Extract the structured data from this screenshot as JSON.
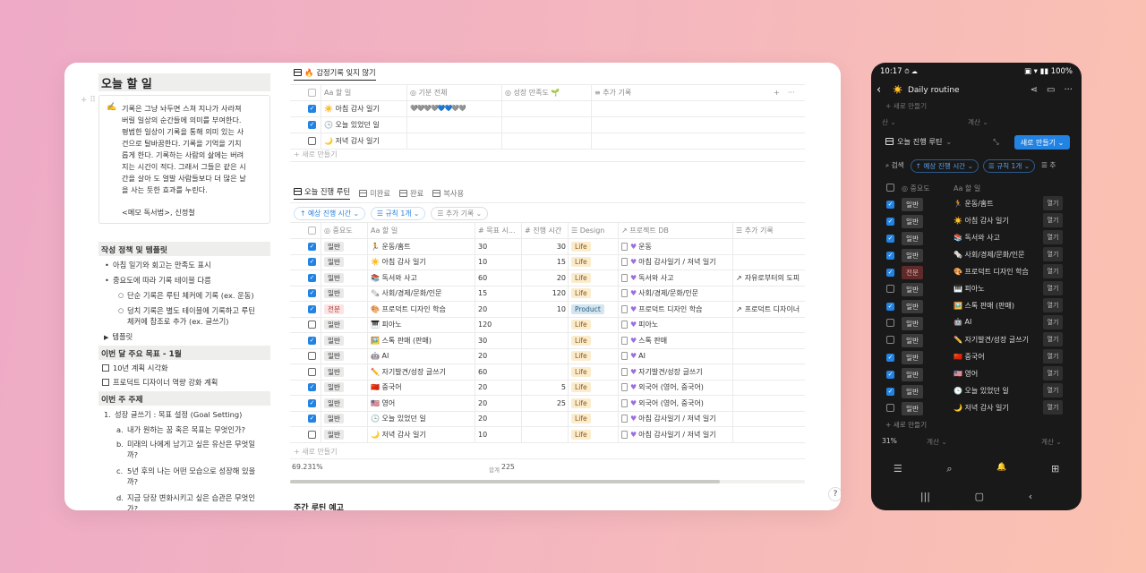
{
  "left": {
    "title": "오늘 할 일",
    "callout_lines": [
      "기록은 그냥 놔두면 스쳐 지나가 사라져",
      "버릴 일상의 순간들에 의미를 부여한다.",
      "평범한 일상이 기록을 통해 의미 있는 사",
      "건으로 탈바꿈한다. 기록을 기억을 기치",
      "롭게 한다. 기록하는 사람의 삶에는 버려",
      "지는 시간이 적다. 그래서 그들은 같은 시",
      "간을 살아 도 얼발 사람들보다 더 많은 날",
      "을 사는 듯한 효과를 누린다."
    ],
    "callout_memo": "<메모 독서법>, 신정철",
    "sec1": "작성 정책 및 템플릿",
    "sec1_items": [
      "아침 일기와 회고는 만족도 표시",
      "중요도에 따라 기록 테이블 다름"
    ],
    "sec1_sub": [
      "단순 기록은 루틴 체커에 기록 (ex. 운동)",
      "덩치 기록은 별도 테이블에 기록하고 루틴",
      "체커에 참조로 추가 (ex. 글쓰기)"
    ],
    "template_toggle": "템플릿",
    "sec2": "이번 달 주요 목표 - 1월",
    "goals": [
      "10년 계획 시각화",
      "프로덕트 디자이너 역량 강화 계획"
    ],
    "sec3": "이번 주 주제",
    "topic1": "성장 글쓰기 : 목표 설정 (Goal Setting)",
    "topic_items": [
      "내가 원하는 꿈 혹은 목표는 무엇인가?",
      "미래의 나에게 남기고 싶은 유산은 무엇일",
      "까?",
      "5년 후의 나는 어떤 모습으로 성장해 있을",
      "까?",
      "지금 당장 변화시키고 싶은 습관은 무엇인",
      "가?"
    ],
    "topic_markers": [
      "1.",
      "a.",
      "b.",
      "c.",
      "d."
    ]
  },
  "db1": {
    "tab": "감정기록 잊지 않기",
    "tab_emoji": "🔥",
    "headers": [
      "할 일",
      "기분 전체",
      "성장 만족도",
      "추가 기록"
    ],
    "header_prefix": [
      "Aa",
      "◎",
      "◎",
      "≡"
    ],
    "rows": [
      {
        "icon": "☀️",
        "name": "아침 감사 일기",
        "checked": true,
        "mood": "🩶🩶🩶🩶💙💙🩶🩶"
      },
      {
        "icon": "🕒",
        "name": "오늘 있었던 일",
        "checked": true,
        "mood": ""
      },
      {
        "icon": "🌙",
        "name": "저녁 감사 일기",
        "checked": false,
        "mood": ""
      }
    ],
    "new_row": "+ 새로 만들기",
    "add_col": "+",
    "more": "···"
  },
  "db2": {
    "tabs": [
      "오늘 진행 루틴",
      "미완료",
      "완료",
      "복사용"
    ],
    "filters": [
      "↑ 예상 진행 시간 ⌄",
      "☰ 규칙 1개 ⌄",
      "☰ 추가 기록 ⌄"
    ],
    "headers": [
      "◎ 중요도",
      "Aa 할 일",
      "# 목표 시...",
      "# 진행 시간",
      "☰ Design",
      "↗ 프로젝트 DB",
      "☰ 추가 기록"
    ],
    "rows": [
      {
        "checked": true,
        "pri": "일반",
        "icon": "🏃",
        "name": "운동/홈트",
        "goal": "30",
        "done": "30",
        "design": "Life",
        "proj": "운동",
        "extra": ""
      },
      {
        "checked": true,
        "pri": "일반",
        "icon": "☀️",
        "name": "아침 감사 일기",
        "goal": "10",
        "done": "15",
        "design": "Life",
        "proj": "아침 감사일기 / 저녁 일기",
        "extra": ""
      },
      {
        "checked": true,
        "pri": "일반",
        "icon": "📚",
        "name": "독서와 사고",
        "goal": "60",
        "done": "20",
        "design": "Life",
        "proj": "독서와 사고",
        "extra": "자유로부터의 도피"
      },
      {
        "checked": true,
        "pri": "일반",
        "icon": "🗞️",
        "name": "사회/경제/문화/인문",
        "goal": "15",
        "done": "120",
        "design": "Life",
        "proj": "사회/경제/문화/인문",
        "extra": ""
      },
      {
        "checked": true,
        "pri": "전문",
        "icon": "🎨",
        "name": "프로덕트 디자인 학습",
        "goal": "20",
        "done": "10",
        "design": "Product",
        "proj": "프로덕트 디자인 학습",
        "extra": "프로덕트 디자이너"
      },
      {
        "checked": false,
        "pri": "일반",
        "icon": "🎹",
        "name": "피아노",
        "goal": "120",
        "done": "",
        "design": "Life",
        "proj": "피아노",
        "extra": ""
      },
      {
        "checked": true,
        "pri": "일반",
        "icon": "🖼️",
        "name": "스톡 판매 (판매)",
        "goal": "30",
        "done": "",
        "design": "Life",
        "proj": "스톡 판매",
        "extra": ""
      },
      {
        "checked": false,
        "pri": "일반",
        "icon": "🤖",
        "name": "AI",
        "goal": "20",
        "done": "",
        "design": "Life",
        "proj": "AI",
        "extra": ""
      },
      {
        "checked": false,
        "pri": "일반",
        "icon": "✏️",
        "name": "자기발견/성장 글쓰기",
        "goal": "60",
        "done": "",
        "design": "Life",
        "proj": "자기발견/성장 글쓰기",
        "extra": ""
      },
      {
        "checked": true,
        "pri": "일반",
        "icon": "🇨🇳",
        "name": "중국어",
        "goal": "20",
        "done": "5",
        "design": "Life",
        "proj": "외국어 (영어, 중국어)",
        "extra": ""
      },
      {
        "checked": true,
        "pri": "일반",
        "icon": "🇺🇸",
        "name": "영어",
        "goal": "20",
        "done": "25",
        "design": "Life",
        "proj": "외국어 (영어, 중국어)",
        "extra": ""
      },
      {
        "checked": true,
        "pri": "일반",
        "icon": "🕒",
        "name": "오늘 있었던 일",
        "goal": "20",
        "done": "",
        "design": "Life",
        "proj": "아침 감사일기 / 저녁 일기",
        "extra": ""
      },
      {
        "checked": false,
        "pri": "일반",
        "icon": "🌙",
        "name": "저녁 감사 일기",
        "goal": "10",
        "done": "",
        "design": "Life",
        "proj": "아침 감사일기 / 저녁 일기",
        "extra": ""
      }
    ],
    "new_row": "+ 새로 만들기",
    "footer_percent": "69.231%",
    "footer_sum_label": "합계",
    "footer_sum_value": "225"
  },
  "weekly_title": "주간 루틴 예고",
  "help_label": "?",
  "phone": {
    "time": "10:17",
    "status_icons": "⏱ ☁",
    "battery": "▣ ▾ ▮▮ 100%",
    "title_icon": "☀️",
    "title": "Daily routine",
    "faded_new": "+ 새로 만들기",
    "faded_left": "산 ⌄",
    "faded_right": "계산 ⌄",
    "db_name": "오늘 진행 루틴",
    "new_btn": "새로 만들기",
    "filters": [
      "⌕ 검색",
      "↑ 예상 진행 시간 ⌄",
      "☰ 규칙 1개 ⌄",
      "☰ 추"
    ],
    "headers": [
      "◎ 중요도",
      "Aa 할 일"
    ],
    "open_label": "열기",
    "rows": [
      {
        "checked": true,
        "pri": "일반",
        "icon": "🏃",
        "name": "운동/홈트"
      },
      {
        "checked": true,
        "pri": "일반",
        "icon": "☀️",
        "name": "아침 감사 일기"
      },
      {
        "checked": true,
        "pri": "일반",
        "icon": "📚",
        "name": "독서와 사고"
      },
      {
        "checked": true,
        "pri": "일반",
        "icon": "🗞️",
        "name": "사회/경제/문화/인문"
      },
      {
        "checked": true,
        "pri": "전문",
        "icon": "🎨",
        "name": "프로덕트 디자인 학습"
      },
      {
        "checked": false,
        "pri": "일반",
        "icon": "🎹",
        "name": "피아노"
      },
      {
        "checked": true,
        "pri": "일반",
        "icon": "🖼️",
        "name": "스톡 판매 (판매)"
      },
      {
        "checked": false,
        "pri": "일반",
        "icon": "🤖",
        "name": "AI"
      },
      {
        "checked": false,
        "pri": "일반",
        "icon": "✏️",
        "name": "자기발견/성장 글쓰기"
      },
      {
        "checked": true,
        "pri": "일반",
        "icon": "🇨🇳",
        "name": "중국어"
      },
      {
        "checked": true,
        "pri": "일반",
        "icon": "🇺🇸",
        "name": "영어"
      },
      {
        "checked": true,
        "pri": "일반",
        "icon": "🕒",
        "name": "오늘 있었던 일"
      },
      {
        "checked": false,
        "pri": "일반",
        "icon": "🌙",
        "name": "저녁 감사 일기"
      }
    ],
    "new_row": "+ 새로 만들기",
    "footer_percent": "31%",
    "footer_calc1": "계산 ⌄",
    "footer_calc2": "계산 ⌄",
    "nav_icons": [
      "☰",
      "⌕",
      "🔔",
      "⊞"
    ],
    "sys_nav": [
      "|||",
      "▢",
      "‹"
    ]
  },
  "colors": {
    "accent": "#2383e2",
    "heart": "#9b6fdb",
    "life_tag": "#fbeccd",
    "product_tag": "#d3e5ef"
  }
}
